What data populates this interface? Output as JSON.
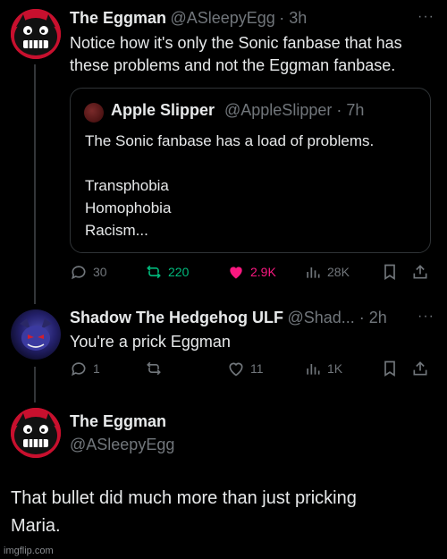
{
  "post1": {
    "name": "The Eggman",
    "handle": "@ASleepyEgg",
    "time": "· 3h",
    "text_line1": "Notice how it's only the Sonic fanbase that has",
    "text_line2": "these problems and not the Eggman fanbase.",
    "more": "···",
    "quote": {
      "name": "Apple Slipper",
      "handle": "@AppleSlipper · 7h",
      "line1": "The Sonic fanbase has a load of problems.",
      "line2": "Transphobia",
      "line3": "Homophobia",
      "line4": "Racism..."
    },
    "stats": {
      "replies": "30",
      "retweets": "220",
      "likes": "2.9K",
      "views": "28K"
    }
  },
  "post2": {
    "name": "Shadow The Hedgehog ULF",
    "handle": "@Shad... · 2h",
    "more": "···",
    "text": "You're a prick Eggman",
    "stats": {
      "replies": "1",
      "retweets": "",
      "likes": "11",
      "views": "1K"
    }
  },
  "post3": {
    "name": "The Eggman",
    "handle": "@ASleepyEgg",
    "text_line1": "That bullet did much more than just pricking",
    "text_line2": "Maria."
  },
  "watermark": "imgflip.com",
  "colors": {
    "background": "#000000",
    "like": "#f91880",
    "retweet": "#00ba7c",
    "muted": "#71767b",
    "avatar": "#c8102e"
  }
}
